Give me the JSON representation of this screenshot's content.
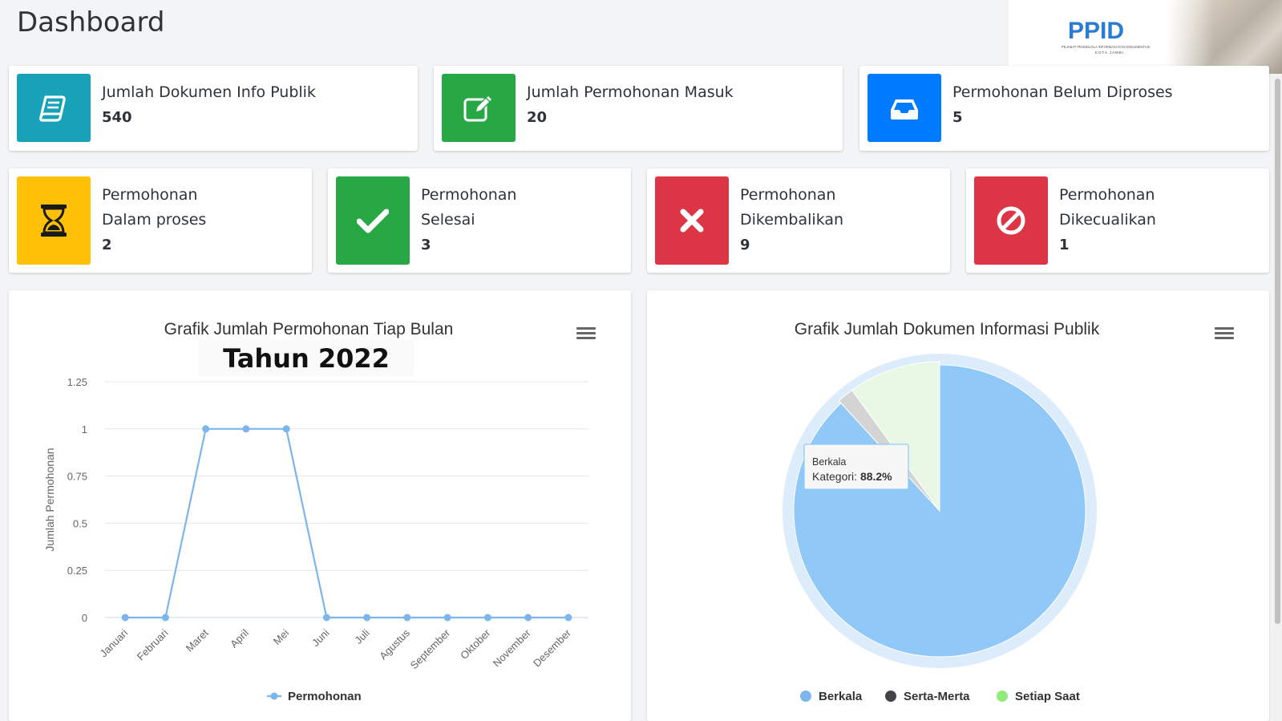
{
  "page": {
    "title": "Dashboard"
  },
  "logo": {
    "text": "PPID",
    "subtitle": "PEJABAT PENGELOLA INFORMASI DAN DOKUMENTASI",
    "city": "KOTA JAMBI"
  },
  "stats_top": [
    {
      "label": "Jumlah Dokumen Info Publik",
      "value": "540",
      "color": "#17a2b8",
      "icon": "book-icon"
    },
    {
      "label": "Jumlah Permohonan Masuk",
      "value": "20",
      "color": "#28a745",
      "icon": "edit-icon"
    },
    {
      "label": "Permohonan Belum Diproses",
      "value": "5",
      "color": "#007bff",
      "icon": "inbox-icon"
    }
  ],
  "stats_bottom": [
    {
      "line1": "Permohonan",
      "line2": "Dalam proses",
      "value": "2",
      "color": "#ffc107",
      "icon": "hourglass-icon"
    },
    {
      "line1": "Permohonan",
      "line2": "Selesai",
      "value": "3",
      "color": "#28a745",
      "icon": "check-icon"
    },
    {
      "line1": "Permohonan",
      "line2": "Dikembalikan",
      "value": "9",
      "color": "#dc3545",
      "icon": "times-icon"
    },
    {
      "line1": "Permohonan",
      "line2": "Dikecualikan",
      "value": "1",
      "color": "#dc3545",
      "icon": "ban-icon"
    }
  ],
  "line_card": {
    "title": "Grafik Jumlah Permohonan Tiap Bulan",
    "year_banner": "Tahun 2022"
  },
  "pie_card": {
    "title": "Grafik Jumlah Dokumen Informasi Publik"
  },
  "chart_data": [
    {
      "type": "line",
      "title": "Grafik Jumlah Permohonan Tiap Bulan",
      "ylabel": "Jumlah Permohonan",
      "ylim": [
        0,
        1.25
      ],
      "yticks": [
        "0",
        "0.25",
        "0.5",
        "0.75",
        "1",
        "1.25"
      ],
      "categories": [
        "Januari",
        "Februari",
        "Maret",
        "April",
        "Mei",
        "Juni",
        "Juli",
        "Agustus",
        "September",
        "Oktober",
        "November",
        "Desember"
      ],
      "series": [
        {
          "name": "Permohonan",
          "values": [
            0,
            0,
            1,
            1,
            1,
            0,
            0,
            0,
            0,
            0,
            0,
            0
          ],
          "color": "#7cb5ec"
        }
      ],
      "grid": true,
      "legend": "bottom"
    },
    {
      "type": "pie",
      "title": "Grafik Jumlah Dokumen Informasi Publik",
      "slices": [
        {
          "name": "Berkala",
          "value": 88.2,
          "color": "#90c8f8"
        },
        {
          "name": "Serta-Merta",
          "value": 1.8,
          "color": "#d4d4d4"
        },
        {
          "name": "Setiap Saat",
          "value": 10.0,
          "color": "#e9f8e4"
        }
      ],
      "legend_colors": [
        "#7cb5ec",
        "#434348",
        "#90ed7d"
      ],
      "tooltip": {
        "title": "Berkala",
        "label": "Kategori: ",
        "value": "88.2%"
      },
      "legend": "bottom"
    }
  ]
}
